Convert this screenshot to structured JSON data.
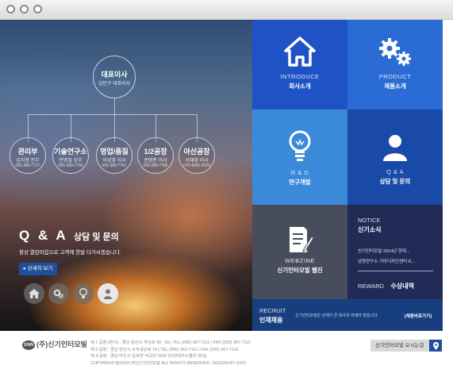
{
  "org": {
    "ceo": {
      "title": "대표이사",
      "name": "김민구 대표이사"
    },
    "departments": [
      {
        "title": "관리부",
        "name": "김지형 전무",
        "phone": "055-380-7727"
      },
      {
        "title": "기술연구소",
        "name": "안병철 상무",
        "phone": "055-380-7703"
      },
      {
        "title": "영업/품질",
        "name": "이성영 이사",
        "phone": "055-380-7751"
      },
      {
        "title": "1/2공장",
        "name": "권병준 이사",
        "phone": "055-380-7785"
      },
      {
        "title": "아산공장",
        "name": "서재영 이사",
        "phone": "070-4942-5520"
      }
    ]
  },
  "hero": {
    "qa_big": "Q & A",
    "qa_small": "상담 및 문의",
    "desc": "항상 열린마음으로 고객께 한발 다가서겠습니다.",
    "more_label": "▸ 상세히 보기"
  },
  "icons": [
    "home-icon",
    "gear-icon",
    "bulb-icon",
    "person-icon"
  ],
  "tiles": {
    "introduce": {
      "en": "INTRODUCE",
      "ko": "회사소개"
    },
    "product": {
      "en": "PRODUCT",
      "ko": "제품소개"
    },
    "rnd": {
      "en": "R & D",
      "ko": "연구개발"
    },
    "qa": {
      "en": "Q & A",
      "ko": "상담 및 문의"
    },
    "webzine": {
      "en": "WEBZINE",
      "ko": "신기인터모빌 웹진"
    }
  },
  "notice": {
    "label": "NOTICE",
    "title": "신기소식",
    "items": [
      "신기인터모빌 2014년 현대...",
      "남양연구소 기아디자인센터 K..."
    ],
    "reward_label": "REWARD",
    "reward_title": "수상내역"
  },
  "recruit": {
    "label": "RECRUIT",
    "title": "인재채용",
    "desc": "신기인터모빌은 인재가 곧 회사의 미래라 믿습니다.",
    "button": "[채용바로가기]"
  },
  "footer": {
    "logo_mark": "SHIN",
    "company": "(주)신기인터모빌",
    "lines": [
      "제 1 공장 (본사) : 경남 양산시 주남로 69 - 60 | TEL (055) 367-7111 | FAX (055) 367-7115",
      "제 2 공장 : 경남 양산시 소주공단로 19 | TEL (055) 363-7111 | FAX (055) 367-7116",
      "제 4 공장 : 경남 아산시 둔포면 석곡리 1543 (아산테크노밸리 자내)",
      "COPYRIGHT@2014 (주)신기인터모빌 ALL RIGHTS RESERVED. DESIGN BY UXIS"
    ],
    "map_label": "신기인터모빌 오시는길"
  },
  "colors": {
    "tile_blue": "#1f52c4",
    "tile_blue_alt": "#2b6bd4",
    "tile_light": "#3b8ad9",
    "tile_dark_blue": "#1a4aa8",
    "tile_gray": "#484d5e",
    "notice_bg": "#222a56",
    "recruit_bg": "#173f7f"
  }
}
